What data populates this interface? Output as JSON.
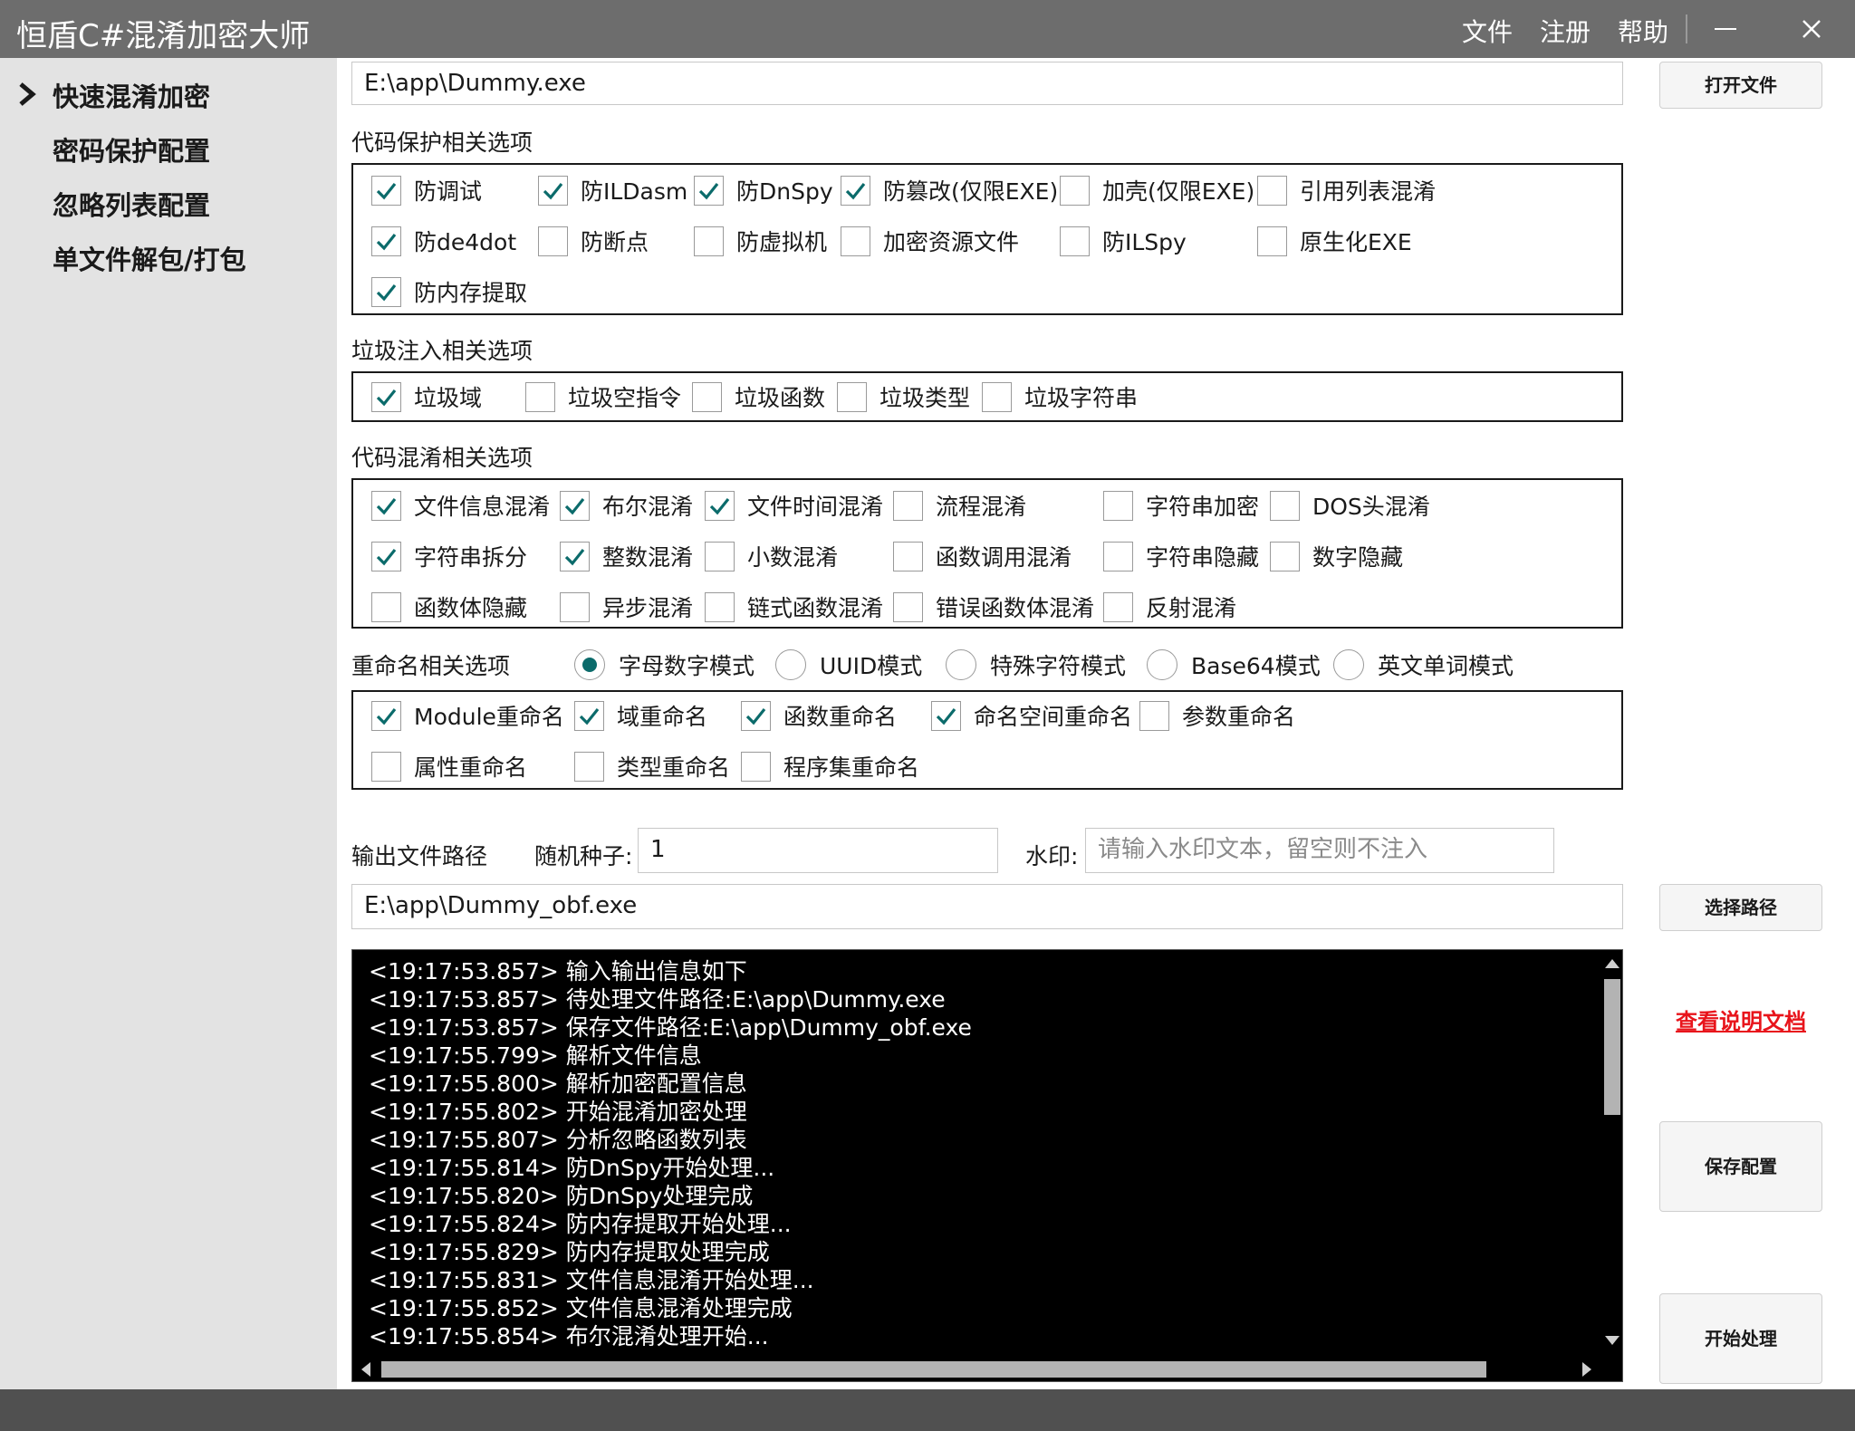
{
  "app": {
    "title": "恒盾C#混淆加密大师",
    "menu": [
      "文件",
      "注册",
      "帮助"
    ]
  },
  "sidebar": {
    "items": [
      "快速混淆加密",
      "密码保护配置",
      "忽略列表配置",
      "单文件解包/打包"
    ],
    "active_index": 0
  },
  "input_file": {
    "value": "E:\\app\\Dummy.exe",
    "open_button": "打开文件"
  },
  "code_protect": {
    "title": "代码保护相关选项",
    "options": [
      {
        "label": "防调试",
        "checked": true
      },
      {
        "label": "防ILDasm",
        "checked": true
      },
      {
        "label": "防DnSpy",
        "checked": true
      },
      {
        "label": "防篡改(仅限EXE)",
        "checked": true
      },
      {
        "label": "加壳(仅限EXE)",
        "checked": false
      },
      {
        "label": "引用列表混淆",
        "checked": false
      },
      {
        "label": "防de4dot",
        "checked": true
      },
      {
        "label": "防断点",
        "checked": false
      },
      {
        "label": "防虚拟机",
        "checked": false
      },
      {
        "label": "加密资源文件",
        "checked": false
      },
      {
        "label": "防ILSpy",
        "checked": false
      },
      {
        "label": "原生化EXE",
        "checked": false
      },
      {
        "label": "防内存提取",
        "checked": true
      }
    ]
  },
  "junk": {
    "title": "垃圾注入相关选项",
    "options": [
      {
        "label": "垃圾域",
        "checked": true
      },
      {
        "label": "垃圾空指令",
        "checked": false
      },
      {
        "label": "垃圾函数",
        "checked": false
      },
      {
        "label": "垃圾类型",
        "checked": false
      },
      {
        "label": "垃圾字符串",
        "checked": false
      }
    ]
  },
  "obfuscation": {
    "title": "代码混淆相关选项",
    "options": [
      {
        "label": "文件信息混淆",
        "checked": true
      },
      {
        "label": "布尔混淆",
        "checked": true
      },
      {
        "label": "文件时间混淆",
        "checked": true
      },
      {
        "label": "流程混淆",
        "checked": false
      },
      {
        "label": "字符串加密",
        "checked": false
      },
      {
        "label": "DOS头混淆",
        "checked": false
      },
      {
        "label": "字符串拆分",
        "checked": true
      },
      {
        "label": "整数混淆",
        "checked": true
      },
      {
        "label": "小数混淆",
        "checked": false
      },
      {
        "label": "函数调用混淆",
        "checked": false
      },
      {
        "label": "字符串隐藏",
        "checked": false
      },
      {
        "label": "数字隐藏",
        "checked": false
      },
      {
        "label": "函数体隐藏",
        "checked": false
      },
      {
        "label": "异步混淆",
        "checked": false
      },
      {
        "label": "链式函数混淆",
        "checked": false
      },
      {
        "label": "错误函数体混淆",
        "checked": false
      },
      {
        "label": "反射混淆",
        "checked": false
      }
    ]
  },
  "rename": {
    "title": "重命名相关选项",
    "modes": [
      {
        "label": "字母数字模式",
        "selected": true
      },
      {
        "label": "UUID模式",
        "selected": false
      },
      {
        "label": "特殊字符模式",
        "selected": false
      },
      {
        "label": "Base64模式",
        "selected": false
      },
      {
        "label": "英文单词模式",
        "selected": false
      }
    ],
    "options": [
      {
        "label": "Module重命名",
        "checked": true
      },
      {
        "label": "域重命名",
        "checked": true
      },
      {
        "label": "函数重命名",
        "checked": true
      },
      {
        "label": "命名空间重命名",
        "checked": true
      },
      {
        "label": "参数重命名",
        "checked": false
      },
      {
        "label": "属性重命名",
        "checked": false
      },
      {
        "label": "类型重命名",
        "checked": false
      },
      {
        "label": "程序集重命名",
        "checked": false
      }
    ]
  },
  "output": {
    "label": "输出文件路径",
    "seed_label": "随机种子:",
    "seed_value": "1",
    "watermark_label": "水印:",
    "watermark_placeholder": "请输入水印文本，留空则不注入",
    "path_value": "E:\\app\\Dummy_obf.exe",
    "choose_button": "选择路径"
  },
  "actions": {
    "doc_link": "查看说明文档",
    "save_button": "保存配置",
    "start_button": "开始处理"
  },
  "log": [
    "<19:17:53.857> 输入输出信息如下",
    "<19:17:53.857> 待处理文件路径:E:\\app\\Dummy.exe",
    "<19:17:53.857> 保存文件路径:E:\\app\\Dummy_obf.exe",
    "<19:17:55.799> 解析文件信息",
    "<19:17:55.800> 解析加密配置信息",
    "<19:17:55.802> 开始混淆加密处理",
    "<19:17:55.807> 分析忽略函数列表",
    "<19:17:55.814> 防DnSpy开始处理...",
    "<19:17:55.820> 防DnSpy处理完成",
    "<19:17:55.824> 防内存提取开始处理...",
    "<19:17:55.829> 防内存提取处理完成",
    "<19:17:55.831> 文件信息混淆开始处理...",
    "<19:17:55.852> 文件信息混淆处理完成",
    "<19:17:55.854> 布尔混淆处理开始..."
  ],
  "colors": {
    "titlebar": "#6d6d6d",
    "sidebar": "#e3e3e3",
    "check": "#0b6b6b",
    "link": "#e8141b",
    "console_bg": "#000000"
  }
}
